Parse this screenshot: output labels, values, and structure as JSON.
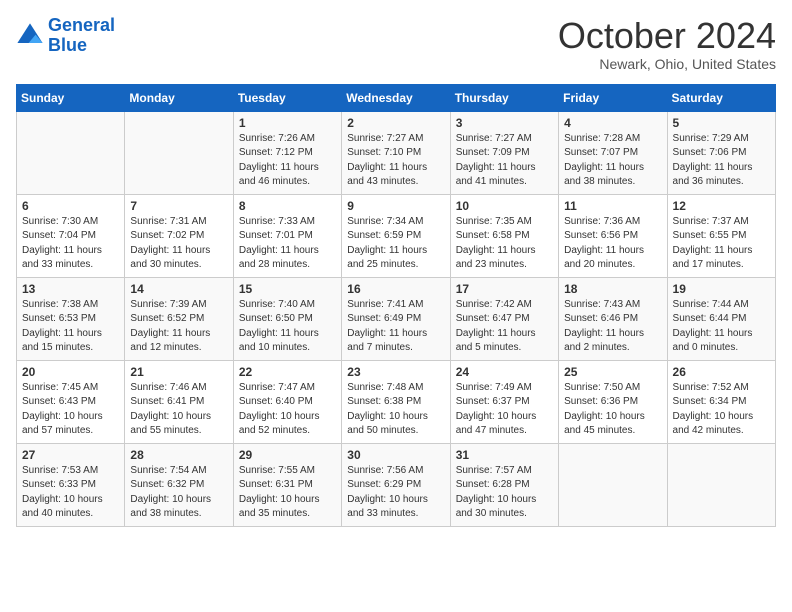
{
  "header": {
    "logo_line1": "General",
    "logo_line2": "Blue",
    "month": "October 2024",
    "location": "Newark, Ohio, United States"
  },
  "weekdays": [
    "Sunday",
    "Monday",
    "Tuesday",
    "Wednesday",
    "Thursday",
    "Friday",
    "Saturday"
  ],
  "weeks": [
    [
      {
        "day": "",
        "info": ""
      },
      {
        "day": "",
        "info": ""
      },
      {
        "day": "1",
        "info": "Sunrise: 7:26 AM\nSunset: 7:12 PM\nDaylight: 11 hours and 46 minutes."
      },
      {
        "day": "2",
        "info": "Sunrise: 7:27 AM\nSunset: 7:10 PM\nDaylight: 11 hours and 43 minutes."
      },
      {
        "day": "3",
        "info": "Sunrise: 7:27 AM\nSunset: 7:09 PM\nDaylight: 11 hours and 41 minutes."
      },
      {
        "day": "4",
        "info": "Sunrise: 7:28 AM\nSunset: 7:07 PM\nDaylight: 11 hours and 38 minutes."
      },
      {
        "day": "5",
        "info": "Sunrise: 7:29 AM\nSunset: 7:06 PM\nDaylight: 11 hours and 36 minutes."
      }
    ],
    [
      {
        "day": "6",
        "info": "Sunrise: 7:30 AM\nSunset: 7:04 PM\nDaylight: 11 hours and 33 minutes."
      },
      {
        "day": "7",
        "info": "Sunrise: 7:31 AM\nSunset: 7:02 PM\nDaylight: 11 hours and 30 minutes."
      },
      {
        "day": "8",
        "info": "Sunrise: 7:33 AM\nSunset: 7:01 PM\nDaylight: 11 hours and 28 minutes."
      },
      {
        "day": "9",
        "info": "Sunrise: 7:34 AM\nSunset: 6:59 PM\nDaylight: 11 hours and 25 minutes."
      },
      {
        "day": "10",
        "info": "Sunrise: 7:35 AM\nSunset: 6:58 PM\nDaylight: 11 hours and 23 minutes."
      },
      {
        "day": "11",
        "info": "Sunrise: 7:36 AM\nSunset: 6:56 PM\nDaylight: 11 hours and 20 minutes."
      },
      {
        "day": "12",
        "info": "Sunrise: 7:37 AM\nSunset: 6:55 PM\nDaylight: 11 hours and 17 minutes."
      }
    ],
    [
      {
        "day": "13",
        "info": "Sunrise: 7:38 AM\nSunset: 6:53 PM\nDaylight: 11 hours and 15 minutes."
      },
      {
        "day": "14",
        "info": "Sunrise: 7:39 AM\nSunset: 6:52 PM\nDaylight: 11 hours and 12 minutes."
      },
      {
        "day": "15",
        "info": "Sunrise: 7:40 AM\nSunset: 6:50 PM\nDaylight: 11 hours and 10 minutes."
      },
      {
        "day": "16",
        "info": "Sunrise: 7:41 AM\nSunset: 6:49 PM\nDaylight: 11 hours and 7 minutes."
      },
      {
        "day": "17",
        "info": "Sunrise: 7:42 AM\nSunset: 6:47 PM\nDaylight: 11 hours and 5 minutes."
      },
      {
        "day": "18",
        "info": "Sunrise: 7:43 AM\nSunset: 6:46 PM\nDaylight: 11 hours and 2 minutes."
      },
      {
        "day": "19",
        "info": "Sunrise: 7:44 AM\nSunset: 6:44 PM\nDaylight: 11 hours and 0 minutes."
      }
    ],
    [
      {
        "day": "20",
        "info": "Sunrise: 7:45 AM\nSunset: 6:43 PM\nDaylight: 10 hours and 57 minutes."
      },
      {
        "day": "21",
        "info": "Sunrise: 7:46 AM\nSunset: 6:41 PM\nDaylight: 10 hours and 55 minutes."
      },
      {
        "day": "22",
        "info": "Sunrise: 7:47 AM\nSunset: 6:40 PM\nDaylight: 10 hours and 52 minutes."
      },
      {
        "day": "23",
        "info": "Sunrise: 7:48 AM\nSunset: 6:38 PM\nDaylight: 10 hours and 50 minutes."
      },
      {
        "day": "24",
        "info": "Sunrise: 7:49 AM\nSunset: 6:37 PM\nDaylight: 10 hours and 47 minutes."
      },
      {
        "day": "25",
        "info": "Sunrise: 7:50 AM\nSunset: 6:36 PM\nDaylight: 10 hours and 45 minutes."
      },
      {
        "day": "26",
        "info": "Sunrise: 7:52 AM\nSunset: 6:34 PM\nDaylight: 10 hours and 42 minutes."
      }
    ],
    [
      {
        "day": "27",
        "info": "Sunrise: 7:53 AM\nSunset: 6:33 PM\nDaylight: 10 hours and 40 minutes."
      },
      {
        "day": "28",
        "info": "Sunrise: 7:54 AM\nSunset: 6:32 PM\nDaylight: 10 hours and 38 minutes."
      },
      {
        "day": "29",
        "info": "Sunrise: 7:55 AM\nSunset: 6:31 PM\nDaylight: 10 hours and 35 minutes."
      },
      {
        "day": "30",
        "info": "Sunrise: 7:56 AM\nSunset: 6:29 PM\nDaylight: 10 hours and 33 minutes."
      },
      {
        "day": "31",
        "info": "Sunrise: 7:57 AM\nSunset: 6:28 PM\nDaylight: 10 hours and 30 minutes."
      },
      {
        "day": "",
        "info": ""
      },
      {
        "day": "",
        "info": ""
      }
    ]
  ]
}
